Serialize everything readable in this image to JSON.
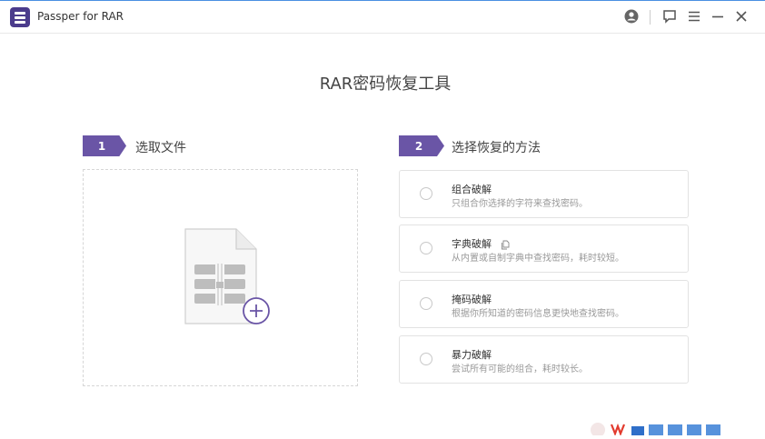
{
  "window": {
    "title": "Passper for RAR",
    "icons": [
      "app-logo-icon",
      "account-icon",
      "feedback-icon",
      "menu-icon",
      "minimize-icon",
      "close-icon"
    ]
  },
  "main": {
    "title": "RAR密码恢复工具"
  },
  "steps": [
    {
      "number": "1",
      "label": "选取文件"
    },
    {
      "number": "2",
      "label": "选择恢复的方法"
    }
  ],
  "drop_zone": {
    "icon": "rar-file-add-icon"
  },
  "methods": [
    {
      "title": "组合破解",
      "description": "只组合你选择的字符来查找密码。"
    },
    {
      "title": "字典破解",
      "description": "从内置或自制字典中查找密码，耗时较短。",
      "extra_icon": "copy-icon"
    },
    {
      "title": "掩码破解",
      "description": "根据你所知道的密码信息更快地查找密码。"
    },
    {
      "title": "暴力破解",
      "description": "尝试所有可能的组合，耗时较长。"
    }
  ],
  "colors": {
    "accent": "#6a55a6",
    "app_icon": "#4b3c8c",
    "top_border": "#4a90e2"
  }
}
